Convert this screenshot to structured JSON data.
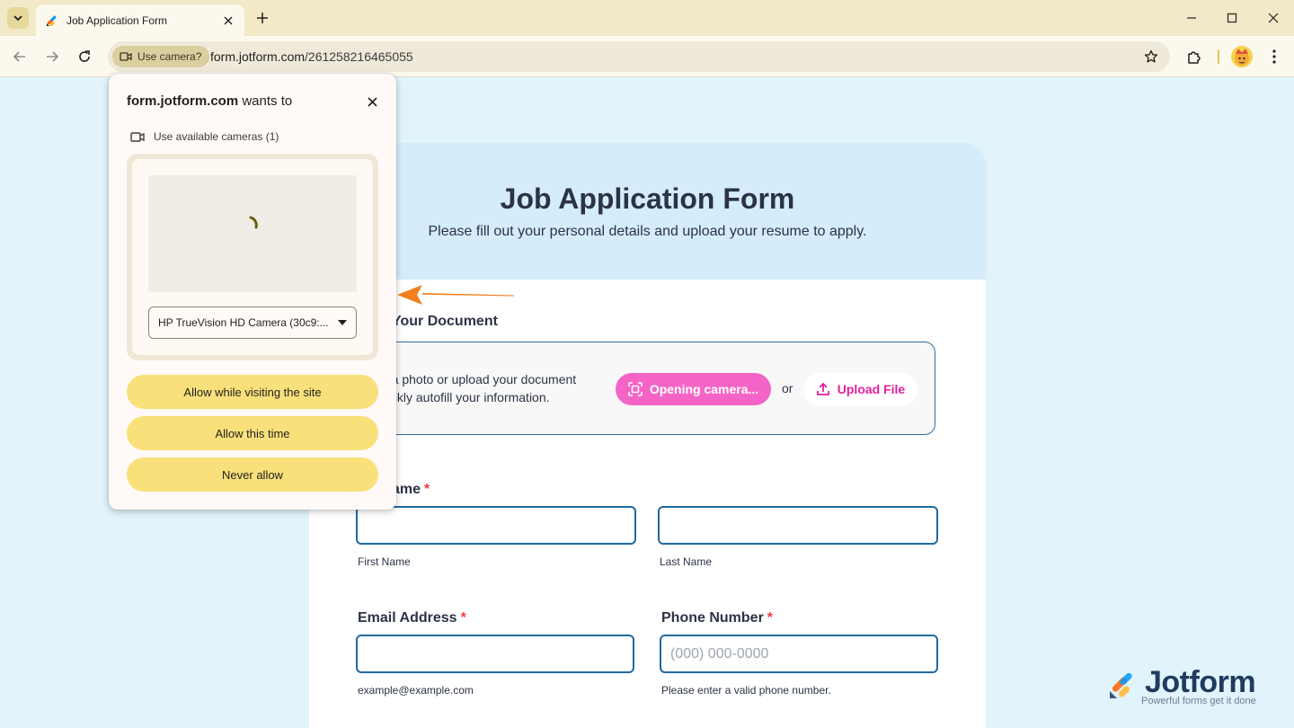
{
  "browser": {
    "tab_title": "Job Application Form",
    "permission_chip": "Use camera?",
    "url_host": "form.jotform.com",
    "url_path": "/261258216465055"
  },
  "icons": {
    "tab_search": "chevron-down-icon",
    "favicon": "jotform-icon",
    "tab_close": "close-icon",
    "new_tab": "plus-icon",
    "back": "arrow-left-icon",
    "forward": "arrow-right-icon",
    "reload": "reload-icon",
    "camera": "video-camera-icon",
    "bookmark": "star-icon",
    "extensions": "puzzle-icon",
    "profile": "avatar-icon",
    "menu": "vertical-dots-icon",
    "minimize": "minimize-icon",
    "maximize": "maximize-icon",
    "close_window": "close-icon",
    "dropdown": "caret-down-icon",
    "scan": "scan-icon",
    "upload": "upload-icon"
  },
  "permission_popup": {
    "site": "form.jotform.com",
    "wants_to": " wants to",
    "request_label": "Use available cameras (1)",
    "selected_camera": "HP TrueVision HD Camera (30c9:...",
    "buttons": {
      "allow_site": "Allow while visiting the site",
      "allow_once": "Allow this time",
      "never": "Never allow"
    }
  },
  "form": {
    "title": "Job Application Form",
    "subtitle": "Please fill out your personal details and upload your resume to apply.",
    "document_section_label": "Your Document",
    "scan_text": "e a photo or upload your document uickly autofill your information.",
    "camera_button": "Opening camera...",
    "or_text": "or",
    "upload_button": "Upload File",
    "name_label": "ame",
    "required_mark": "*",
    "first_name_sublabel": "First Name",
    "last_name_sublabel": "Last Name",
    "email_label": "Email Address",
    "email_sublabel": "example@example.com",
    "phone_label": "Phone Number",
    "phone_placeholder": "(000) 000-0000",
    "phone_sublabel": "Please enter a valid phone number."
  },
  "watermark": {
    "name": "Jotform",
    "tagline": "Powerful forms get it done"
  },
  "colors": {
    "page_bg": "#e1f3fb",
    "header_bg": "#d4ecfb",
    "accent_pink": "#f464c6",
    "input_border": "#1f6aa0",
    "perm_button": "#f9e07a",
    "annotation_arrow": "#f07f1c"
  }
}
